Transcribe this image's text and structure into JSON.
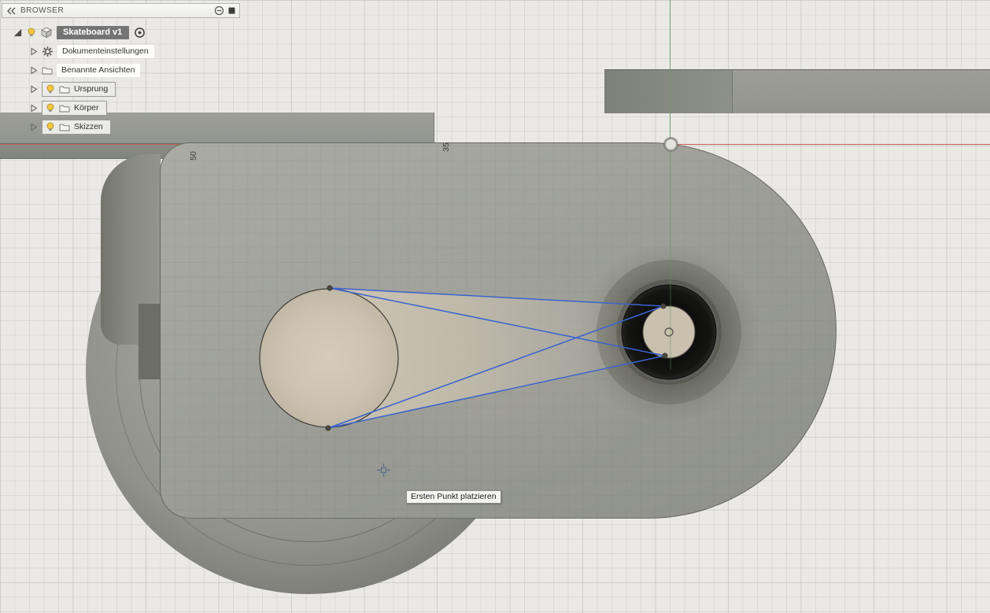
{
  "browser": {
    "title": "BROWSER",
    "items": [
      {
        "label": "Skateboard v1"
      },
      {
        "label": "Dokumenteinstellungen"
      },
      {
        "label": "Benannte Ansichten"
      },
      {
        "label": "Ursprung"
      },
      {
        "label": "Körper"
      },
      {
        "label": "Skizzen"
      }
    ]
  },
  "viewport": {
    "tooltip": "Ersten Punkt platzieren",
    "dimension_labels": [
      "50",
      "35"
    ],
    "colors": {
      "sketch_line": "#3a63cf",
      "axis_x": "#ca584e",
      "axis_y": "#6c9e64",
      "profile_fill": "#cdc4b3",
      "body_gray": "#9a9c95",
      "hole_black": "#101010"
    }
  }
}
